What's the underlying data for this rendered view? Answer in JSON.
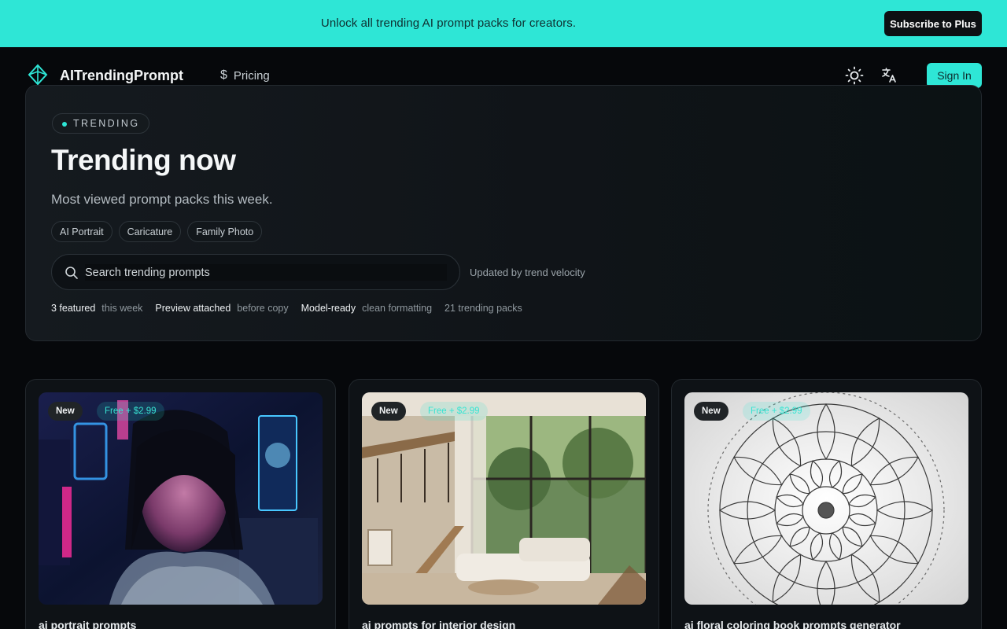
{
  "promo": {
    "text": "Unlock all trending AI prompt packs for creators.",
    "button": "Subscribe to Plus"
  },
  "nav": {
    "brand": "AITrendingPrompt",
    "pricing": "Pricing",
    "pricing_icon": "dollar-icon",
    "theme_icon": "sun-icon",
    "language_icon": "translate-icon",
    "signin": "Sign In"
  },
  "hero": {
    "badge": "TRENDING",
    "title": "Trending now",
    "subtitle": "Most viewed prompt packs this week.",
    "chips": [
      "AI Portrait",
      "Caricature",
      "Family Photo"
    ],
    "search_placeholder": "Search trending prompts",
    "updated": "Updated by trend velocity",
    "stats": [
      {
        "strong": "3 featured",
        "muted": "this week"
      },
      {
        "strong": "Preview attached",
        "muted": "before copy"
      },
      {
        "strong": "Model-ready",
        "muted": "clean formatting"
      }
    ],
    "pack_count": "21 trending packs"
  },
  "cards": [
    {
      "badge": "New",
      "price": "Free + $2.99",
      "title": "ai portrait prompts",
      "image": "neon-portrait"
    },
    {
      "badge": "New",
      "price": "Free + $2.99",
      "title": "ai prompts for interior design",
      "image": "interior-living-room"
    },
    {
      "badge": "New",
      "price": "Free + $2.99",
      "title": "ai floral coloring book prompts generator",
      "image": "floral-mandala"
    }
  ],
  "colors": {
    "accent": "#2ee6d6",
    "background": "#06080b",
    "panel": "#12171b"
  }
}
